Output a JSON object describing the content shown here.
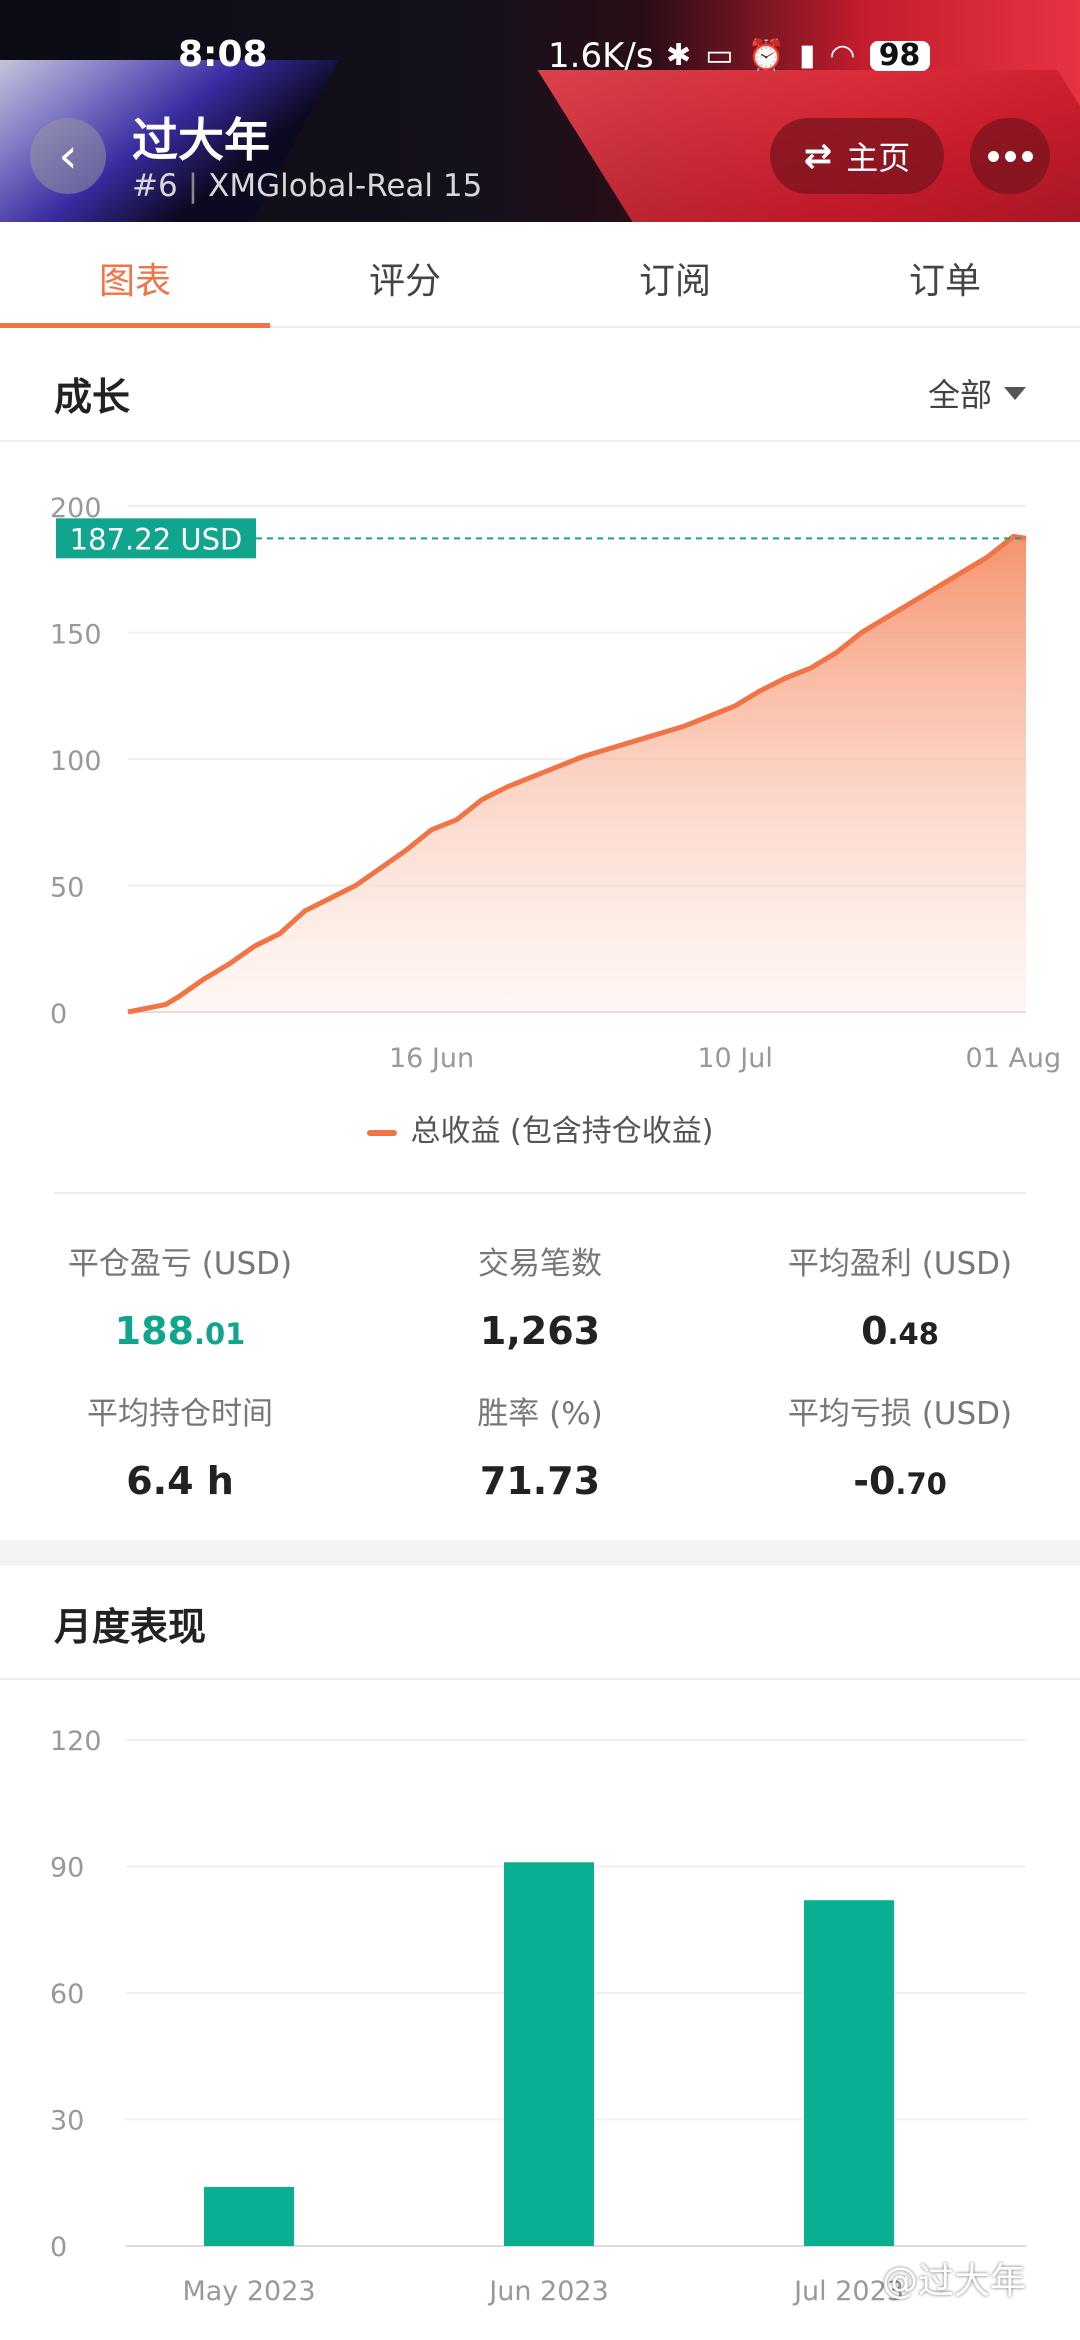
{
  "status_bar": {
    "time": "8:08",
    "net_speed": "1.6K/s",
    "icons": [
      "bluetooth-icon",
      "vibrate-icon",
      "alarm-icon",
      "signal-icon",
      "wifi-icon"
    ],
    "battery": "98"
  },
  "header": {
    "title": "过大年",
    "rank": "#6",
    "account": "XMGlobal-Real 15",
    "home_label": "主页"
  },
  "tabs": [
    {
      "label": "图表",
      "active": true
    },
    {
      "label": "评分",
      "active": false
    },
    {
      "label": "订阅",
      "active": false
    },
    {
      "label": "订单",
      "active": false
    }
  ],
  "growth": {
    "title": "成长",
    "filter": "全部",
    "legend": "总收益 (包含持仓收益)"
  },
  "stats": [
    {
      "label": "平仓盈亏 (USD)",
      "int": "188",
      "dec": ".01",
      "highlight": true
    },
    {
      "label": "交易笔数",
      "int": "1,263",
      "dec": "",
      "highlight": false
    },
    {
      "label": "平均盈利 (USD)",
      "int": "0",
      "dec": ".48",
      "highlight": false
    },
    {
      "label": "平均持仓时间",
      "int": "6.4 h",
      "dec": "",
      "highlight": false
    },
    {
      "label": "胜率 (%)",
      "int": "71.73",
      "dec": "",
      "highlight": false
    },
    {
      "label": "平均亏损 (USD)",
      "int": "-0",
      "dec": ".70",
      "highlight": false
    }
  ],
  "monthly": {
    "title": "月度表现"
  },
  "colors": {
    "accent": "#f07445",
    "green": "#12a58e",
    "bar": "#0aae91"
  },
  "watermark": "@过大年",
  "chart_data": [
    {
      "type": "area",
      "title": "",
      "ylim": [
        0,
        200
      ],
      "yticks": [
        0,
        50,
        100,
        150,
        200
      ],
      "x_tick_labels": [
        "16 Jun",
        "10 Jul",
        "01 Aug"
      ],
      "x_domain": [
        "2023-05-23",
        "2023-08-02"
      ],
      "x_ticks": [
        "2023-06-16",
        "2023-07-10",
        "2023-08-01"
      ],
      "current_value_label": "187.22 USD",
      "current_value": 187.22,
      "series": [
        {
          "name": "总收益 (包含持仓收益)",
          "x": [
            "2023-05-23",
            "2023-05-26",
            "2023-05-27",
            "2023-05-29",
            "2023-05-31",
            "2023-06-02",
            "2023-06-04",
            "2023-06-06",
            "2023-06-08",
            "2023-06-10",
            "2023-06-12",
            "2023-06-14",
            "2023-06-16",
            "2023-06-18",
            "2023-06-20",
            "2023-06-22",
            "2023-06-24",
            "2023-06-26",
            "2023-06-28",
            "2023-06-30",
            "2023-07-02",
            "2023-07-04",
            "2023-07-06",
            "2023-07-08",
            "2023-07-10",
            "2023-07-12",
            "2023-07-14",
            "2023-07-16",
            "2023-07-18",
            "2023-07-20",
            "2023-07-22",
            "2023-07-24",
            "2023-07-26",
            "2023-07-28",
            "2023-07-30",
            "2023-08-01",
            "2023-08-02"
          ],
          "y": [
            0,
            3,
            6,
            13,
            19,
            26,
            31,
            40,
            45,
            50,
            57,
            64,
            72,
            76,
            84,
            89,
            93,
            97,
            101,
            104,
            107,
            110,
            113,
            117,
            121,
            127,
            132,
            136,
            142,
            150,
            156,
            162,
            168,
            174,
            180,
            188,
            187.22
          ]
        }
      ]
    },
    {
      "type": "bar",
      "title": "",
      "categories": [
        "May 2023",
        "Jun 2023",
        "Jul 2023"
      ],
      "values": [
        14,
        91,
        82
      ],
      "ylim": [
        0,
        120
      ],
      "yticks": [
        0,
        30,
        60,
        90,
        120
      ]
    }
  ]
}
